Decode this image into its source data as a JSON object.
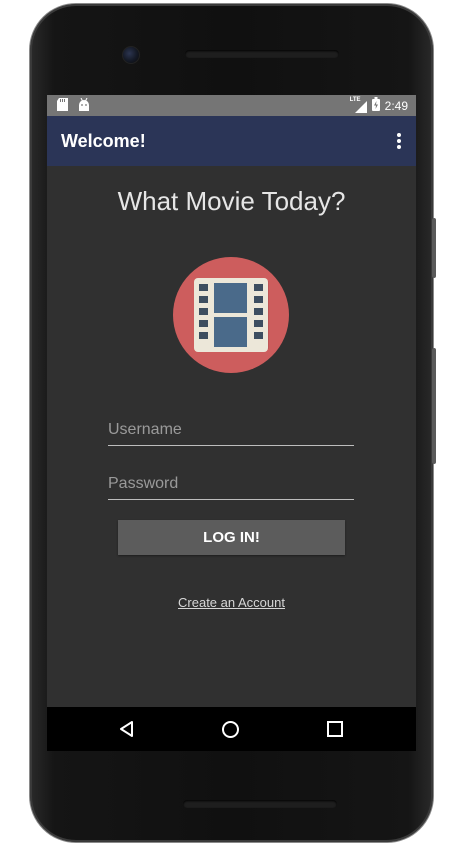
{
  "statusbar": {
    "time": "2:49",
    "network": "LTE"
  },
  "appbar": {
    "title": "Welcome!"
  },
  "main": {
    "headline": "What Movie Today?",
    "username": {
      "value": "",
      "placeholder": "Username"
    },
    "password": {
      "value": "",
      "placeholder": "Password"
    },
    "login_label": "LOG IN!",
    "create_account_label": "Create an Account"
  },
  "colors": {
    "appbar": "#2b3557",
    "screen_bg": "#303030",
    "statusbar": "#757575",
    "logo_circle": "#cd5d5d",
    "button": "#5c5c5c"
  },
  "icons": [
    "sd-card-icon",
    "android-icon",
    "lte-signal-icon",
    "battery-icon",
    "overflow-menu-icon",
    "film-strip-icon",
    "back-icon",
    "home-icon",
    "recents-icon"
  ]
}
